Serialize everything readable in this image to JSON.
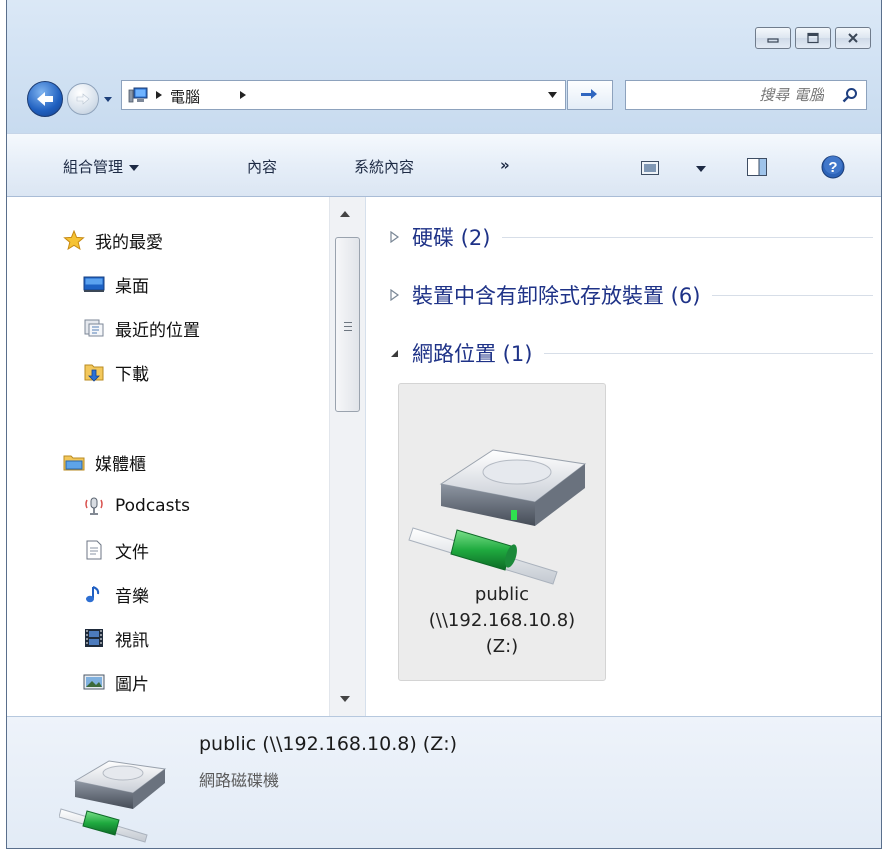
{
  "address": {
    "path_segment": "電腦",
    "search_placeholder": "搜尋 電腦"
  },
  "commands": {
    "organize": "組合管理",
    "properties": "內容",
    "system_properties": "系統內容",
    "more": "»"
  },
  "navigation": {
    "favorites": {
      "label": "我的最愛",
      "items": [
        "桌面",
        "最近的位置",
        "下載"
      ]
    },
    "libraries": {
      "label": "媒體櫃",
      "items": [
        "Podcasts",
        "文件",
        "音樂",
        "視訊",
        "圖片"
      ]
    }
  },
  "groups": [
    {
      "label": "硬碟 (2)",
      "expanded": false
    },
    {
      "label": "裝置中含有卸除式存放裝置 (6)",
      "expanded": false
    },
    {
      "label": "網路位置 (1)",
      "expanded": true
    }
  ],
  "network_item": {
    "name_line1": "public",
    "name_line2": "(\\\\192.168.10.8)",
    "name_line3": "(Z:)"
  },
  "details": {
    "name": "public (\\\\192.168.10.8) (Z:)",
    "type": "網路磁碟機"
  },
  "colors": {
    "group_header": "#1e3287",
    "accent_green": "#2fae4a"
  }
}
